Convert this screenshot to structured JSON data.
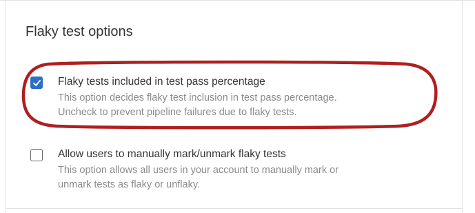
{
  "section": {
    "title": "Flaky test options"
  },
  "options": [
    {
      "label": "Flaky tests included in test pass percentage",
      "description_line1": "This option decides flaky test inclusion in test pass percentage.",
      "description_line2": "Uncheck to prevent pipeline failures due to flaky tests.",
      "checked": true
    },
    {
      "label": "Allow users to manually mark/unmark flaky tests",
      "description_line1": "This option allows all users in your account to manually mark or",
      "description_line2": "unmark tests as flaky or unflaky.",
      "checked": false
    }
  ],
  "colors": {
    "accent": "#2b6fc9",
    "highlight": "#b01f1f",
    "text": "#333333",
    "muted": "#8a8a8a"
  },
  "icons": {
    "checkmark": "checkmark-icon"
  }
}
